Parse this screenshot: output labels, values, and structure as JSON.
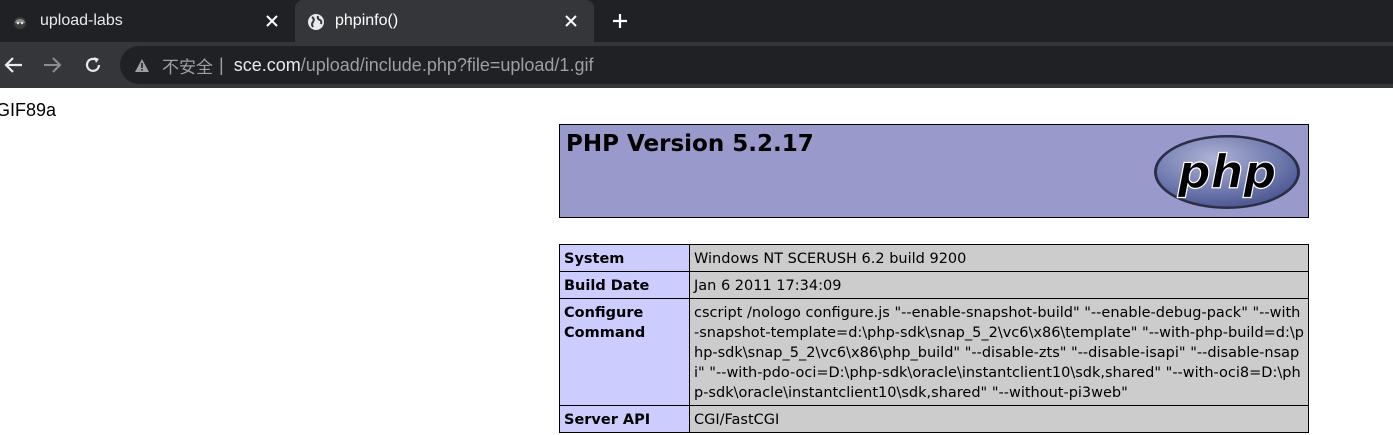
{
  "browser": {
    "tabs": [
      {
        "title": "upload-labs",
        "favicon": "app-favicon-icon",
        "active": false
      },
      {
        "title": "phpinfo()",
        "favicon": "globe-icon",
        "active": true
      }
    ],
    "address": {
      "security_label": "不安全",
      "separator": "|",
      "host": "sce.com",
      "path": "/upload/include.php?file=upload/1.gif"
    },
    "colors": {
      "tabstrip": "#202124",
      "active_tab": "#35363a",
      "omnibox": "#202124"
    }
  },
  "page": {
    "gif_header": "GIF89a",
    "php_title": "PHP Version 5.2.17",
    "logo_text": "php",
    "rows": [
      {
        "key": "System",
        "value": "Windows NT SCERUSH 6.2 build 9200"
      },
      {
        "key": "Build Date",
        "value": "Jan 6 2011 17:34:09"
      },
      {
        "key": "Configure Command",
        "value": "cscript /nologo configure.js \"--enable-snapshot-build\" \"--enable-debug-pack\" \"--with-snapshot-template=d:\\php-sdk\\snap_5_2\\vc6\\x86\\template\" \"--with-php-build=d:\\php-sdk\\snap_5_2\\vc6\\x86\\php_build\" \"--disable-zts\" \"--disable-isapi\" \"--disable-nsapi\" \"--with-pdo-oci=D:\\php-sdk\\oracle\\instantclient10\\sdk,shared\" \"--with-oci8=D:\\php-sdk\\oracle\\instantclient10\\sdk,shared\" \"--without-pi3web\""
      },
      {
        "key": "Server API",
        "value": "CGI/FastCGI"
      }
    ],
    "colors": {
      "header": "#9999cc",
      "key_cell": "#ccccff",
      "value_cell": "#cccccc"
    }
  }
}
